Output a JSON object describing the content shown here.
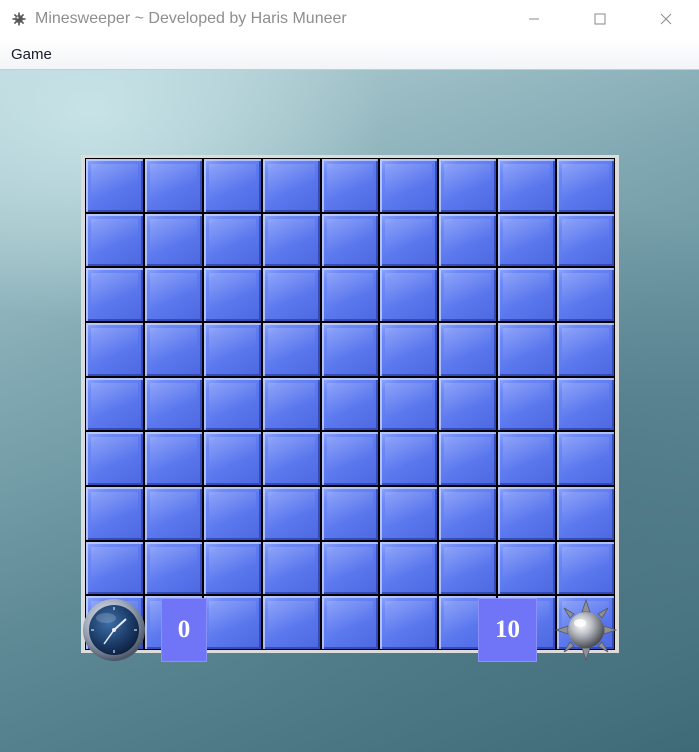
{
  "window": {
    "title": "Minesweeper ~ Developed by Haris Muneer",
    "app_icon": "mine-gear-icon",
    "controls": [
      "minimize-icon",
      "maximize-icon",
      "close-icon"
    ]
  },
  "menu": {
    "items": [
      {
        "label": "Game"
      }
    ]
  },
  "board": {
    "rows": 9,
    "cols": 9,
    "cell_state": "covered",
    "cell_color": "#5b78ee"
  },
  "status": {
    "timer_icon": "clock-icon",
    "timer_value": "0",
    "mine_count": "10",
    "mine_icon": "mine-icon",
    "counter_color": "#6f75f6"
  }
}
